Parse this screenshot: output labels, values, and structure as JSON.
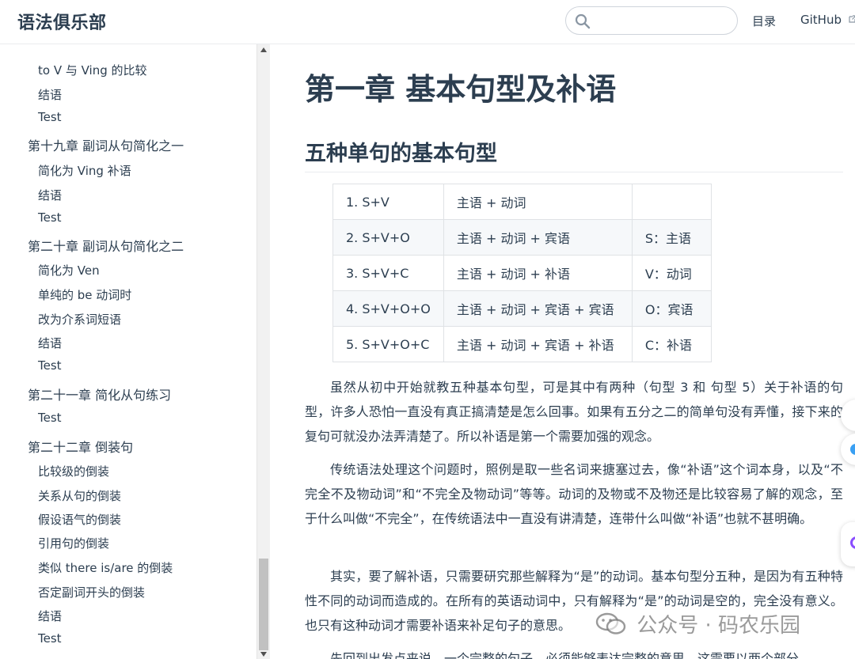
{
  "site": {
    "title": "语法俱乐部"
  },
  "nav": {
    "search_placeholder": "",
    "toc_label": "目录",
    "github_label": "GitHub"
  },
  "sidebar": {
    "items": [
      {
        "label": "to V 与 Ving 的比较",
        "level": "sub"
      },
      {
        "label": "结语",
        "level": "sub"
      },
      {
        "label": "Test",
        "level": "sub"
      },
      {
        "label": "第十九章 副词从句简化之一",
        "level": "chapter"
      },
      {
        "label": "简化为 Ving 补语",
        "level": "sub"
      },
      {
        "label": "结语",
        "level": "sub"
      },
      {
        "label": "Test",
        "level": "sub"
      },
      {
        "label": "第二十章 副词从句简化之二",
        "level": "chapter"
      },
      {
        "label": "简化为 Ven",
        "level": "sub"
      },
      {
        "label": "单纯的 be 动词时",
        "level": "sub"
      },
      {
        "label": "改为介系词短语",
        "level": "sub"
      },
      {
        "label": "结语",
        "level": "sub"
      },
      {
        "label": "Test",
        "level": "sub"
      },
      {
        "label": "第二十一章 简化从句练习",
        "level": "chapter"
      },
      {
        "label": "Test",
        "level": "sub"
      },
      {
        "label": "第二十二章 倒装句",
        "level": "chapter"
      },
      {
        "label": "比较级的倒装",
        "level": "sub"
      },
      {
        "label": "关系从句的倒装",
        "level": "sub"
      },
      {
        "label": "假设语气的倒装",
        "level": "sub"
      },
      {
        "label": "引用句的倒装",
        "level": "sub"
      },
      {
        "label": "类似 there is/are 的倒装",
        "level": "sub"
      },
      {
        "label": "否定副词开头的倒装",
        "level": "sub"
      },
      {
        "label": "结语",
        "level": "sub"
      },
      {
        "label": "Test",
        "level": "sub"
      }
    ]
  },
  "content": {
    "h1": "第一章 基本句型及补语",
    "h2": "五种单句的基本句型",
    "table": [
      [
        "1. S+V",
        "主语 + 动词",
        ""
      ],
      [
        "2. S+V+O",
        "主语 + 动词 + 宾语",
        "S：主语"
      ],
      [
        "3. S+V+C",
        "主语 + 动词 + 补语",
        "V：动词"
      ],
      [
        "4. S+V+O+O",
        "主语 + 动词 + 宾语 + 宾语",
        "O：宾语"
      ],
      [
        "5. S+V+O+C",
        "主语 + 动词 + 宾语 + 补语",
        "C：补语"
      ]
    ],
    "paragraphs": [
      "虽然从初中开始就教五种基本句型，可是其中有两种（句型 3 和 句型 5）关于补语的句型，许多人恐怕一直没有真正搞清楚是怎么回事。如果有五分之二的简单句没有弄懂，接下来的复句可就没办法弄清楚了。所以补语是第一个需要加强的观念。",
      "传统语法处理这个问题时，照例是取一些名词来搪塞过去，像“补语”这个词本身，以及“不完全不及物动词”和“不完全及物动词”等等。动词的及物或不及物还是比较容易了解的观念，至于什么叫做“不完全”，在传统语法中一直没有讲清楚，连带什么叫做“补语”也就不甚明确。",
      "其实，要了解补语，只需要研究那些解释为“是”的动词。基本句型分五种，是因为有五种特性不同的动词而造成的。在所有的英语动词中，只有解释为“是”的动词是空的，完全没有意义。也只有这种动词才需要补语来补足句子的意思。",
      "先回到出发点来说，一个完整的句子，必须能够表达完整的意思，这需要以两个部分"
    ]
  },
  "watermark": {
    "text": "公众号 · 码农乐园"
  }
}
